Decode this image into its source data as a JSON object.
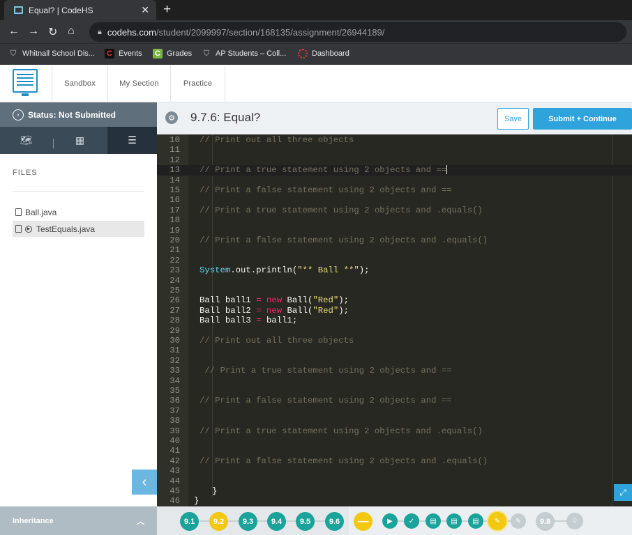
{
  "browser": {
    "tab_title": "Equal? | CodeHS",
    "tab_close": "✕",
    "new_tab": "+",
    "url_host": "codehs.com",
    "url_path": "/student/2099997/section/168135/assignment/26944189/",
    "bookmarks": [
      {
        "label": "Whitnall School Dis...",
        "icon": "shield-icon"
      },
      {
        "label": "Events",
        "icon": "C"
      },
      {
        "label": "Grades",
        "icon": "C"
      },
      {
        "label": "AP Students – Coll...",
        "icon": "shield-icon"
      },
      {
        "label": "Dashboard",
        "icon": "circle-icon"
      }
    ]
  },
  "app": {
    "nav": [
      "Sandbox",
      "My Section",
      "Practice"
    ]
  },
  "sidebar": {
    "status": "Status: Not Submitted",
    "files_heading": "FILES",
    "files": [
      "Ball.java",
      "TestEquals.java"
    ],
    "unit": "Inheritance"
  },
  "assignment": {
    "title": "9.7.6: Equal?",
    "save": "Save",
    "submit": "Submit + Continue"
  },
  "editor": {
    "lines": [
      {
        "n": "10",
        "t": "    // Print out all three objects"
      },
      {
        "n": "11",
        "t": ""
      },
      {
        "n": "12",
        "t": ""
      },
      {
        "n": "13",
        "t": "    // Print a true statement using 2 objects and =="
      },
      {
        "n": "14",
        "t": ""
      },
      {
        "n": "15",
        "t": "    // Print a false statement using 2 objects and =="
      },
      {
        "n": "16",
        "t": ""
      },
      {
        "n": "17",
        "t": "    // Print a true statement using 2 objects and .equals()"
      },
      {
        "n": "18",
        "t": ""
      },
      {
        "n": "19",
        "t": ""
      },
      {
        "n": "20",
        "t": "    // Print a false statement using 2 objects and .equals()"
      },
      {
        "n": "21",
        "t": ""
      },
      {
        "n": "22",
        "t": ""
      },
      {
        "n": "23",
        "t": "    System.out.println(\"** Ball **\");"
      },
      {
        "n": "24",
        "t": ""
      },
      {
        "n": "25",
        "t": ""
      },
      {
        "n": "26",
        "t": "    Ball ball1 = new Ball(\"Red\");"
      },
      {
        "n": "27",
        "t": "    Ball ball2 = new Ball(\"Red\");"
      },
      {
        "n": "28",
        "t": "    Ball ball3 = ball1;"
      },
      {
        "n": "29",
        "t": ""
      },
      {
        "n": "30",
        "t": "    // Print out all three objects"
      },
      {
        "n": "31",
        "t": ""
      },
      {
        "n": "32",
        "t": ""
      },
      {
        "n": "33",
        "t": "     // Print a true statement using 2 objects and =="
      },
      {
        "n": "34",
        "t": ""
      },
      {
        "n": "35",
        "t": ""
      },
      {
        "n": "36",
        "t": "    // Print a false statement using 2 objects and =="
      },
      {
        "n": "37",
        "t": ""
      },
      {
        "n": "38",
        "t": ""
      },
      {
        "n": "39",
        "t": "    // Print a true statement using 2 objects and .equals()"
      },
      {
        "n": "40",
        "t": ""
      },
      {
        "n": "41",
        "t": ""
      },
      {
        "n": "42",
        "t": "    // Print a false statement using 2 objects and .equals()"
      },
      {
        "n": "43",
        "t": ""
      },
      {
        "n": "44",
        "t": ""
      },
      {
        "n": "45",
        "t": "}"
      },
      {
        "n": "46",
        "t": "}"
      }
    ]
  },
  "lessons": {
    "items": [
      "9.1",
      "9.2",
      "9.3",
      "9.4",
      "9.5",
      "9.6"
    ],
    "next": "9.8",
    "colors": {
      "teal": "#1aa39a",
      "yellow": "#f2c811",
      "grey": "#c5cdd1"
    }
  }
}
